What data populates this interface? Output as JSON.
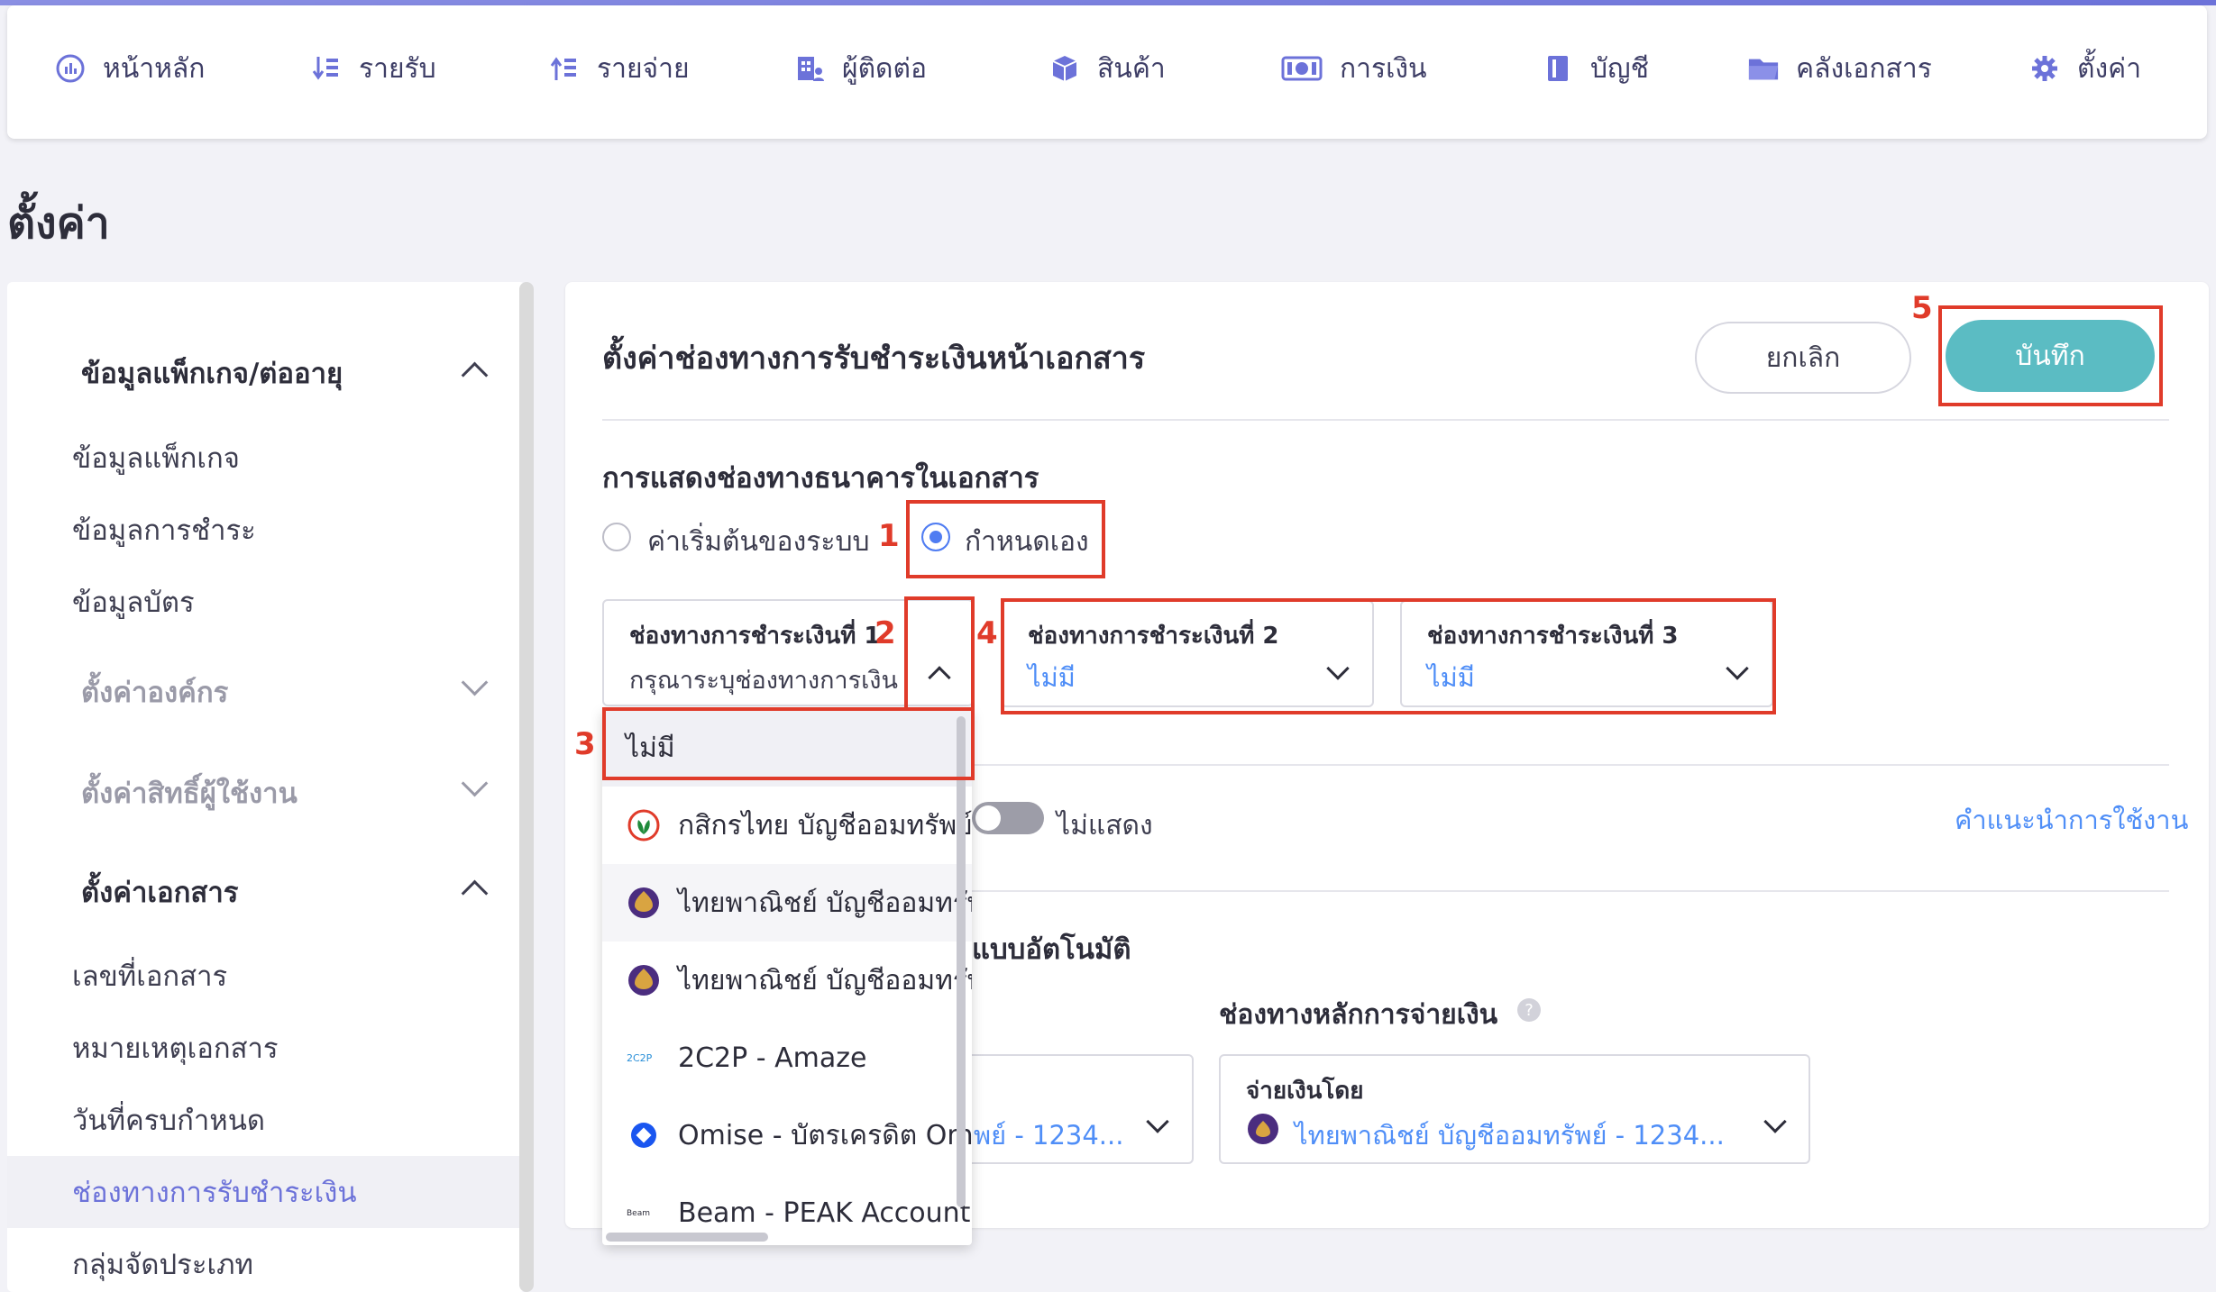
{
  "nav": {
    "items": [
      {
        "label": "หน้าหลัก",
        "icon": "dashboard-icon"
      },
      {
        "label": "รายรับ",
        "icon": "income-icon"
      },
      {
        "label": "รายจ่าย",
        "icon": "expense-icon"
      },
      {
        "label": "ผู้ติดต่อ",
        "icon": "contacts-icon"
      },
      {
        "label": "สินค้า",
        "icon": "product-box-icon"
      },
      {
        "label": "การเงิน",
        "icon": "money-icon"
      },
      {
        "label": "บัญชี",
        "icon": "ledger-book-icon"
      },
      {
        "label": "คลังเอกสาร",
        "icon": "folder-icon"
      },
      {
        "label": "ตั้งค่า",
        "icon": "gear-icon"
      }
    ]
  },
  "page": {
    "title": "ตั้งค่า"
  },
  "sidebar": {
    "package_section": "ข้อมูลแพ็กเกจ/ต่ออายุ",
    "package_items": [
      "ข้อมูลแพ็กเกจ",
      "ข้อมูลการชำระ",
      "ข้อมูลบัตร"
    ],
    "org_section": "ตั้งค่าองค์กร",
    "permission_section": "ตั้งค่าสิทธิ์ผู้ใช้งาน",
    "document_section": "ตั้งค่าเอกสาร",
    "document_items": [
      "เลขที่เอกสาร",
      "หมายเหตุเอกสาร",
      "วันที่ครบกำหนด",
      "ช่องทางการรับชำระเงิน",
      "กลุ่มจัดประเภท"
    ],
    "active_item": "ช่องทางการรับชำระเงิน"
  },
  "main": {
    "title": "ตั้งค่าช่องทางการรับชำระเงินหน้าเอกสาร",
    "cancel_label": "ยกเลิก",
    "save_label": "บันทึก",
    "bank_display_title": "การแสดงช่องทางธนาคารในเอกสาร",
    "radio_default": "ค่าเริ่มต้นของระบบ",
    "radio_custom": "กำหนดเอง",
    "selected_radio": "กำหนดเอง",
    "channel1": {
      "label": "ช่องทางการชำระเงินที่ 1",
      "value": "กรุณาระบุช่องทางการเงิน"
    },
    "channel2": {
      "label": "ช่องทางการชำระเงินที่ 2",
      "value": "ไม่มี"
    },
    "channel3": {
      "label": "ช่องทางการชำระเงินที่ 3",
      "value": "ไม่มี"
    },
    "dropdown_options": [
      {
        "label": "ไม่มี",
        "icon": ""
      },
      {
        "label": "กสิกรไทย บัญชีออมทรัพย์",
        "icon": "kbank-logo-icon"
      },
      {
        "label": "ไทยพาณิชย์ บัญชีออมทรัพย์",
        "icon": "scb-logo-icon"
      },
      {
        "label": "ไทยพาณิชย์ บัญชีออมทรัพย์",
        "icon": "scb-logo-icon"
      },
      {
        "label": "2C2P - Amaze",
        "icon": "2c2p-logo-icon"
      },
      {
        "label": "Omise - บัตรเครดิต Omise",
        "icon": "omise-logo-icon"
      },
      {
        "label": "Beam - PEAK Account",
        "icon": "beam-logo-icon"
      }
    ],
    "toggle_label": "ไม่แสดง",
    "toggle_on": false,
    "help_link": "คำแนะนำการใช้งาน",
    "auto_section_partial": "แบบอัตโนมัติ",
    "main_pay_channel_label": "ช่องทางหลักการจ่ายเงิน",
    "help_icon": "?",
    "left_select_partial": "พย์ - 1234...",
    "pay_by": {
      "label": "จ่ายเงินโดย",
      "value": "ไทยพาณิชย์ บัญชีออมทรัพย์ - 1234..."
    }
  },
  "annotations": [
    "1",
    "2",
    "3",
    "4",
    "5"
  ],
  "colors": {
    "accent": "#5bbcc3",
    "link": "#4f8ef7",
    "annotation": "#e03b2a",
    "nav_text": "#3e3e66",
    "scb": "#4b2d7f",
    "kbank": "#1f8a3b"
  }
}
